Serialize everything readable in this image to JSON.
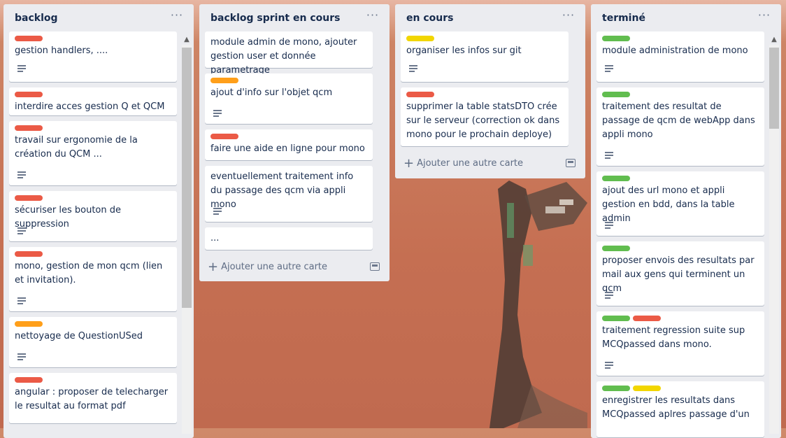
{
  "colors": {
    "red": "#eb5a46",
    "orange": "#ff9f1a",
    "yellow": "#f2d600",
    "green": "#61bd4f"
  },
  "lists": [
    {
      "title": "backlog",
      "cards": [
        {
          "labels": [
            "red"
          ],
          "title": "gestion handlers, ....",
          "has_description": true
        },
        {
          "labels": [
            "red"
          ],
          "title": "interdire acces gestion Q et QCM ...",
          "has_description": false
        },
        {
          "labels": [
            "red"
          ],
          "title": "travail sur ergonomie de la création du QCM ...",
          "has_description": true
        },
        {
          "labels": [
            "red"
          ],
          "title": "sécuriser les bouton de suppression",
          "has_description": true
        },
        {
          "labels": [
            "red"
          ],
          "title": "mono, gestion de mon qcm (lien et invitation).",
          "has_description": true
        },
        {
          "labels": [
            "orange"
          ],
          "title": "nettoyage de QuestionUSed",
          "has_description": true
        },
        {
          "labels": [
            "red"
          ],
          "title": "angular : proposer de telecharger le resultat au format pdf",
          "has_description": false
        }
      ]
    },
    {
      "title": "backlog sprint en cours",
      "cards": [
        {
          "labels": [],
          "title": "module admin de mono, ajouter gestion user et donnée parametrage",
          "has_description": false
        },
        {
          "labels": [
            "orange"
          ],
          "title": "ajout d'info sur l'objet qcm",
          "has_description": true
        },
        {
          "labels": [
            "red"
          ],
          "title": "faire une aide en ligne pour mono",
          "has_description": false
        },
        {
          "labels": [],
          "title": "eventuellement traitement info du passage des qcm via appli mono",
          "has_description": true
        },
        {
          "labels": [],
          "title": "...",
          "has_description": false
        }
      ],
      "add_card": "Ajouter une autre carte"
    },
    {
      "title": "en cours",
      "cards": [
        {
          "labels": [
            "yellow"
          ],
          "title": "organiser les infos sur git",
          "has_description": true
        },
        {
          "labels": [
            "red"
          ],
          "title": "supprimer la table statsDTO crée sur le serveur (correction ok dans mono pour le prochain deploye)",
          "has_description": false
        }
      ],
      "add_card": "Ajouter une autre carte"
    },
    {
      "title": "terminé",
      "cards": [
        {
          "labels": [
            "green"
          ],
          "title": "module administration de mono",
          "has_description": true
        },
        {
          "labels": [
            "green"
          ],
          "title": "traitement des resultat de passage de qcm de webApp dans appli mono",
          "has_description": true
        },
        {
          "labels": [
            "green"
          ],
          "title": "ajout des url mono et appli gestion en bdd, dans la table admin",
          "has_description": true
        },
        {
          "labels": [
            "green"
          ],
          "title": "proposer envois des resultats par mail aux gens qui terminent un qcm",
          "has_description": true
        },
        {
          "labels": [
            "green",
            "red"
          ],
          "title": "traitement regression suite sup MCQpassed dans mono.",
          "has_description": true
        },
        {
          "labels": [
            "green",
            "yellow"
          ],
          "title": "enregistrer les resultats dans MCQpassed aplres passage d'un",
          "has_description": false
        }
      ]
    }
  ],
  "icons": {
    "list_menu": "more-horizontal-icon",
    "description": "description-icon",
    "add": "plus-icon",
    "template": "card-template-icon",
    "scroll_up": "scroll-up-arrow-icon"
  },
  "glyphs": {
    "menu": "···",
    "plus": "+",
    "scroll_up": "▲"
  }
}
